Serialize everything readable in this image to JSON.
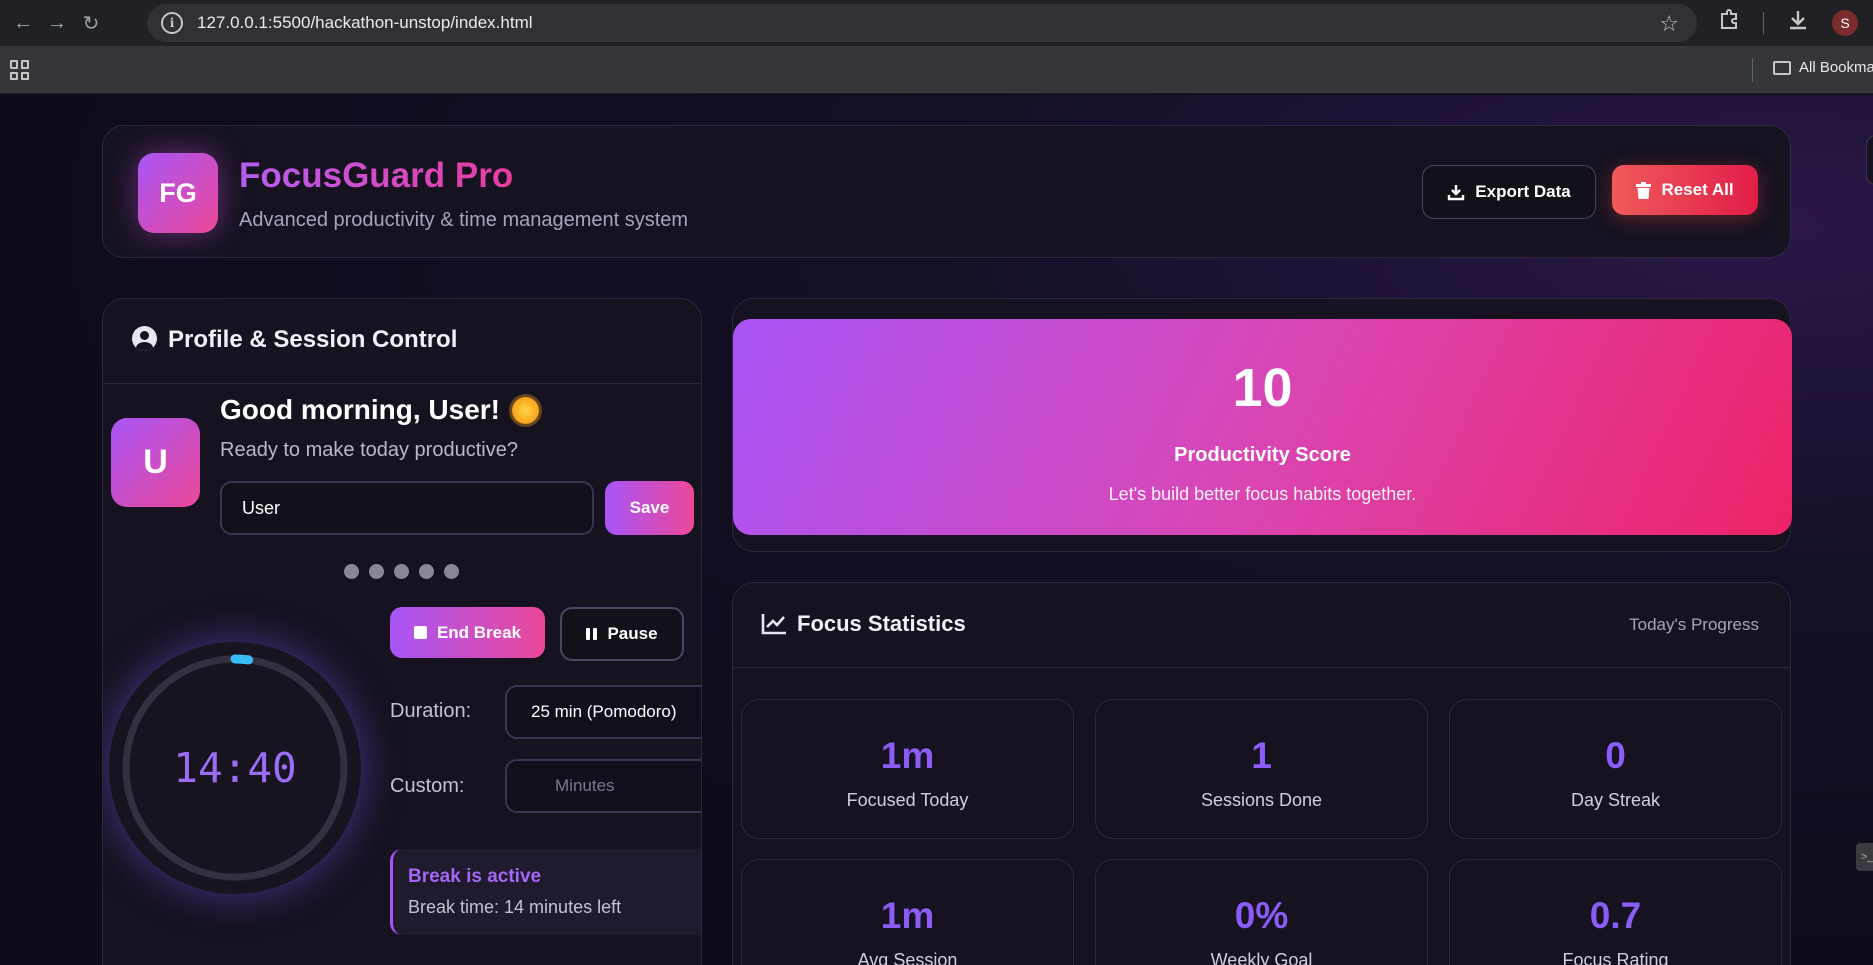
{
  "browser": {
    "url": "127.0.0.1:5500/hackathon-unstop/index.html",
    "profile_initial": "S",
    "bookmarks_label": "All Bookma"
  },
  "header": {
    "logo": "FG",
    "title": "FocusGuard Pro",
    "subtitle": "Advanced productivity & time management system",
    "export_label": "Export Data",
    "reset_label": "Reset All"
  },
  "profile": {
    "title": "Profile & Session Control",
    "avatar_initial": "U",
    "greeting": "Good morning, User!",
    "greeting_sub": "Ready to make today productive?",
    "name_value": "User",
    "save_label": "Save",
    "dot_count": 5,
    "timer": "14:40",
    "timer_progress": 0.02,
    "end_break_label": "End Break",
    "pause_label": "Pause",
    "duration_label": "Duration:",
    "duration_value": "25 min (Pomodoro)",
    "custom_label": "Custom:",
    "custom_placeholder": "Minutes",
    "break_title": "Break is active",
    "break_sub": "Break time: 14 minutes left"
  },
  "score": {
    "value": "10",
    "label": "Productivity Score",
    "message": "Let's build better focus habits together."
  },
  "stats": {
    "title": "Focus Statistics",
    "subtitle": "Today's Progress",
    "tiles": [
      {
        "value": "1m",
        "label": "Focused Today"
      },
      {
        "value": "1",
        "label": "Sessions Done"
      },
      {
        "value": "0",
        "label": "Day Streak"
      },
      {
        "value": "1m",
        "label": "Avg Session"
      },
      {
        "value": "0%",
        "label": "Weekly Goal"
      },
      {
        "value": "0.7",
        "label": "Focus Rating"
      }
    ]
  },
  "colors": {
    "accent_purple": "#a855f7",
    "accent_pink": "#ec4899",
    "stat_value": "#8b5cf6",
    "timer_arc": "#38bdf8",
    "danger": "#ef4444"
  }
}
